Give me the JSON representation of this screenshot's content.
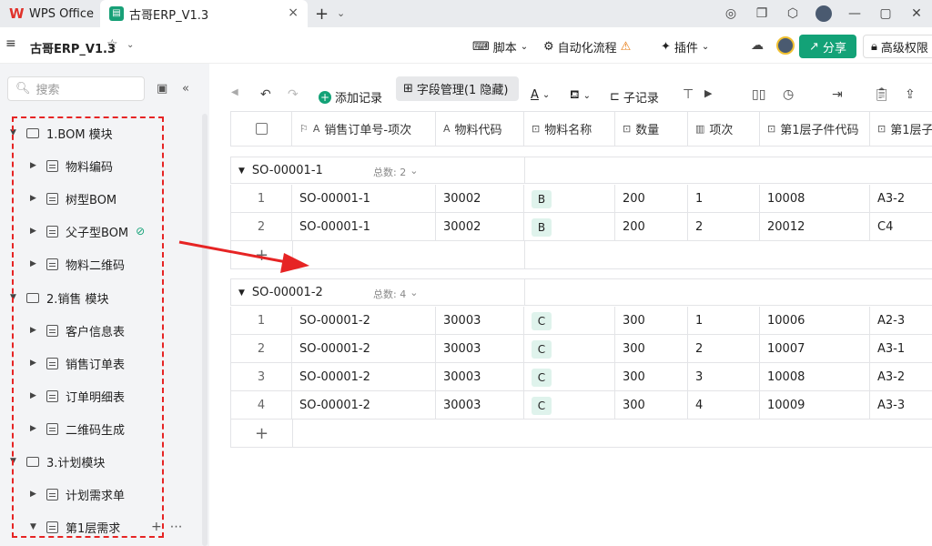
{
  "tabs": {
    "wps_label": "WPS Office",
    "doc_label": "古哥ERP_V1.3",
    "close": "×",
    "new": "+",
    "new_drop": "⌄"
  },
  "docbar": {
    "menu": "≡",
    "title": "古哥ERP_V1.3",
    "star": "☆",
    "dropdown": "⌄",
    "script": "脚本",
    "automation": "自动化流程",
    "plugins": "插件",
    "share": "分享",
    "permission": "高级权限"
  },
  "sidebar": {
    "search_placeholder": "搜索",
    "groups": [
      {
        "label": "1.BOM 模块",
        "items": [
          "物料编码",
          "树型BOM",
          "父子型BOM",
          "物料二维码"
        ]
      },
      {
        "label": "2.销售 模块",
        "items": [
          "客户信息表",
          "销售订单表",
          "订单明细表",
          "二维码生成"
        ]
      },
      {
        "label": "3.计划模块",
        "items": [
          "计划需求单",
          "第1层需求"
        ]
      }
    ]
  },
  "toolbar": {
    "add_record": "添加记录",
    "field_manage": "字段管理(1 隐藏)",
    "text_a": "A",
    "sub_record": "子记录"
  },
  "grid": {
    "columns": [
      "销售订单号-项次",
      "物料代码",
      "物料名称",
      "数量",
      "项次",
      "第1层子件代码",
      "第1层子"
    ],
    "groups": [
      {
        "title": "SO-00001-1",
        "count_label": "总数: 2",
        "rows": [
          {
            "idx": "1",
            "so": "SO-00001-1",
            "code": "30002",
            "name": "B",
            "qty": "200",
            "item": "1",
            "child": "10008",
            "c1": "A3-2"
          },
          {
            "idx": "2",
            "so": "SO-00001-1",
            "code": "30002",
            "name": "B",
            "qty": "200",
            "item": "2",
            "child": "20012",
            "c1": "C4"
          }
        ]
      },
      {
        "title": "SO-00001-2",
        "count_label": "总数: 4",
        "rows": [
          {
            "idx": "1",
            "so": "SO-00001-2",
            "code": "30003",
            "name": "C",
            "qty": "300",
            "item": "1",
            "child": "10006",
            "c1": "A2-3"
          },
          {
            "idx": "2",
            "so": "SO-00001-2",
            "code": "30003",
            "name": "C",
            "qty": "300",
            "item": "2",
            "child": "10007",
            "c1": "A3-1"
          },
          {
            "idx": "3",
            "so": "SO-00001-2",
            "code": "30003",
            "name": "C",
            "qty": "300",
            "item": "3",
            "child": "10008",
            "c1": "A3-2"
          },
          {
            "idx": "4",
            "so": "SO-00001-2",
            "code": "30003",
            "name": "C",
            "qty": "300",
            "item": "4",
            "child": "10009",
            "c1": "A3-3"
          }
        ]
      }
    ]
  },
  "colors": {
    "accent": "#13a277",
    "annotation": "#e62424"
  }
}
